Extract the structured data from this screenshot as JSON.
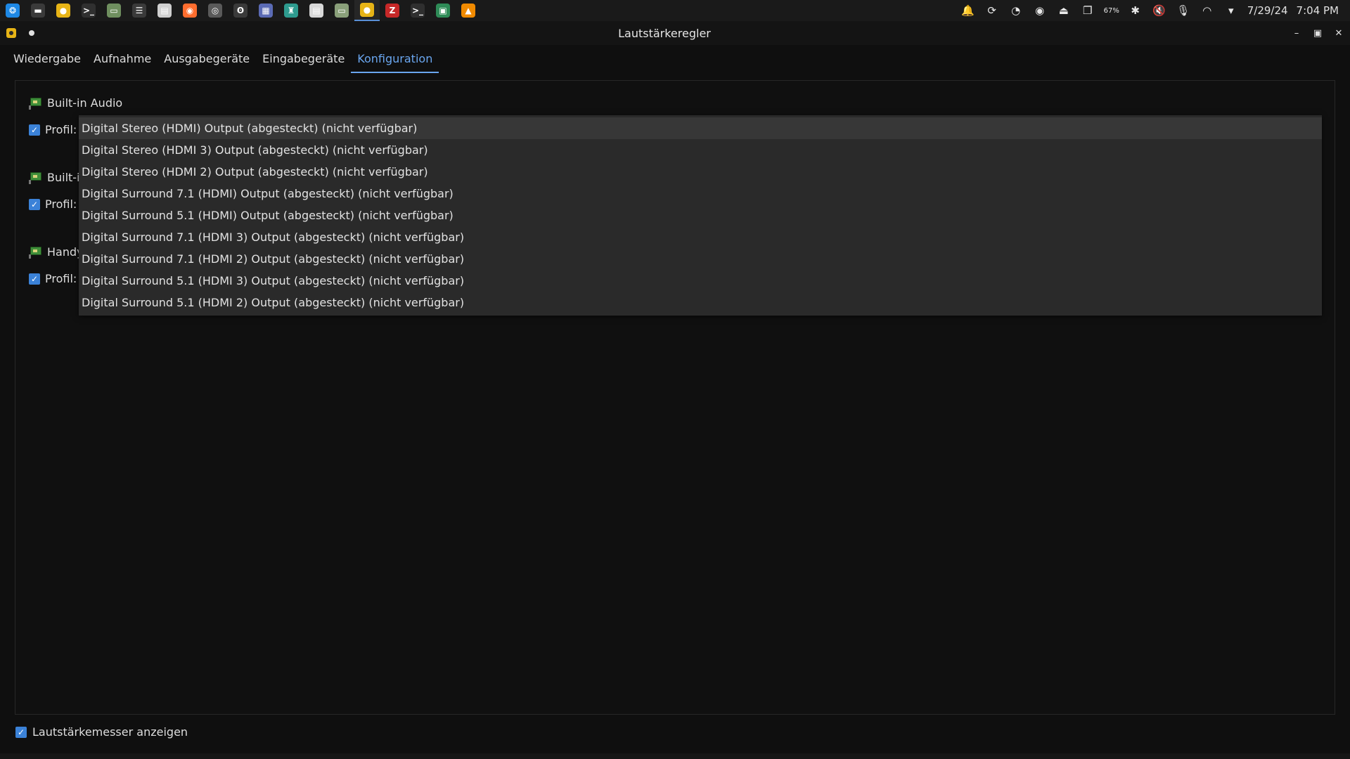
{
  "taskbar": {
    "apps": [
      {
        "name": "launcher-icon",
        "glyph": "❂",
        "color": "#1e88e5"
      },
      {
        "name": "files-icon",
        "glyph": "▬",
        "color": "#3a3a3a"
      },
      {
        "name": "volume-app-icon",
        "glyph": "●",
        "color": "#e7b416"
      },
      {
        "name": "terminal-icon",
        "glyph": ">_",
        "color": "#303030"
      },
      {
        "name": "drive-icon",
        "glyph": "▭",
        "color": "#6f8f5f"
      },
      {
        "name": "archive-icon",
        "glyph": "☰",
        "color": "#3a3a3a"
      },
      {
        "name": "document-icon",
        "glyph": "▤",
        "color": "#d0d0d0"
      },
      {
        "name": "firefox-icon",
        "glyph": "◉",
        "color": "#ff6d2e"
      },
      {
        "name": "chromium-icon",
        "glyph": "◎",
        "color": "#5a5a5a"
      },
      {
        "name": "mascot-icon",
        "glyph": "ʘ",
        "color": "#3a3a3a"
      },
      {
        "name": "network-tool-icon",
        "glyph": "▦",
        "color": "#5b6bb5"
      },
      {
        "name": "android-tool-icon",
        "glyph": "♜",
        "color": "#2e9b8f"
      },
      {
        "name": "pdf-icon",
        "glyph": "▤",
        "color": "#d8d8d8"
      },
      {
        "name": "disk-icon",
        "glyph": "▭",
        "color": "#8aa07a"
      },
      {
        "name": "volume-control-icon",
        "glyph": "●",
        "color": "#e7b416"
      },
      {
        "name": "filezilla-icon",
        "glyph": "Z",
        "color": "#c62828"
      },
      {
        "name": "console-icon",
        "glyph": ">_",
        "color": "#2f2f2f"
      },
      {
        "name": "android-icon",
        "glyph": "▣",
        "color": "#2e8b57"
      },
      {
        "name": "vlc-icon",
        "glyph": "▲",
        "color": "#f08a00"
      }
    ],
    "active_app_index": 14,
    "tray": [
      {
        "name": "notification-bell-icon",
        "glyph": "🔔",
        "small": false
      },
      {
        "name": "sync-icon",
        "glyph": "⟳",
        "small": false
      },
      {
        "name": "screenshot-tool-icon",
        "glyph": "◔",
        "small": false
      },
      {
        "name": "steam-icon",
        "glyph": "◉",
        "small": false
      },
      {
        "name": "update-icon",
        "glyph": "⏏",
        "small": false
      },
      {
        "name": "clipboard-icon",
        "glyph": "❐",
        "small": false
      },
      {
        "name": "battery-icon",
        "glyph": "67%",
        "small": true
      },
      {
        "name": "bluetooth-icon",
        "glyph": "✱",
        "small": false
      },
      {
        "name": "speaker-muted-icon",
        "glyph": "🔇",
        "small": false
      },
      {
        "name": "microphone-icon",
        "glyph": "🎙",
        "small": false
      },
      {
        "name": "wifi-icon",
        "glyph": "◠",
        "small": false
      },
      {
        "name": "tray-expand-icon",
        "glyph": "▾",
        "small": false
      }
    ],
    "date": "7/29/24",
    "time": "7:04 PM"
  },
  "window": {
    "title": "Lautstärkeregler"
  },
  "tabs": [
    {
      "label": "Wiedergabe",
      "active": false
    },
    {
      "label": "Aufnahme",
      "active": false
    },
    {
      "label": "Ausgabegeräte",
      "active": false
    },
    {
      "label": "Eingabegeräte",
      "active": false
    },
    {
      "label": "Konfiguration",
      "active": true
    }
  ],
  "cards": [
    {
      "title": "Built-in Audio",
      "profile_label": "Profil:"
    },
    {
      "title": "Built-in Audio",
      "profile_label": "Profil:"
    },
    {
      "title": "Handy",
      "profile_label": "Profil:"
    }
  ],
  "dropdown": {
    "selected_index": 0,
    "options": [
      "Digital Stereo (HDMI) Output (abgesteckt) (nicht verfügbar)",
      "Digital Stereo (HDMI 3) Output (abgesteckt) (nicht verfügbar)",
      "Digital Stereo (HDMI 2) Output (abgesteckt) (nicht verfügbar)",
      "Digital Surround 7.1 (HDMI) Output (abgesteckt) (nicht verfügbar)",
      "Digital Surround 5.1 (HDMI) Output (abgesteckt) (nicht verfügbar)",
      "Digital Surround 7.1 (HDMI 3) Output (abgesteckt) (nicht verfügbar)",
      "Digital Surround 7.1 (HDMI 2) Output (abgesteckt) (nicht verfügbar)",
      "Digital Surround 5.1 (HDMI 3) Output (abgesteckt) (nicht verfügbar)",
      "Digital Surround 5.1 (HDMI 2) Output (abgesteckt) (nicht verfügbar)"
    ]
  },
  "footer": {
    "show_meters_label": "Lautstärkemesser anzeigen"
  }
}
